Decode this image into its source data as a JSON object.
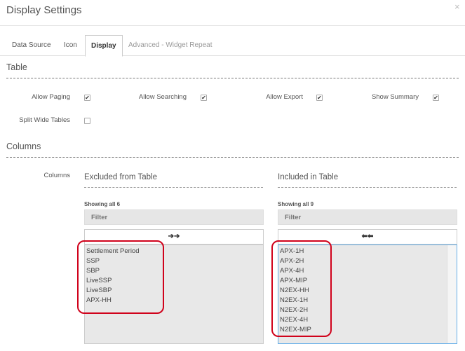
{
  "modal": {
    "title": "Display Settings",
    "close_glyph": "×"
  },
  "tabs": [
    {
      "label": "Data Source"
    },
    {
      "label": "Icon"
    },
    {
      "label": "Display"
    },
    {
      "label": "Advanced - Widget Repeat"
    }
  ],
  "table_section": {
    "title": "Table",
    "options": [
      {
        "label": "Allow Paging",
        "checked": "✔"
      },
      {
        "label": "Allow Searching",
        "checked": "✔"
      },
      {
        "label": "Allow Export",
        "checked": "✔"
      },
      {
        "label": "Show Summary",
        "checked": "✔"
      },
      {
        "label": "Split Wide Tables",
        "checked": ""
      }
    ]
  },
  "columns_section": {
    "title": "Columns",
    "field_label": "Columns",
    "excluded": {
      "title": "Excluded from Table",
      "showing": "Showing all 6",
      "filter_placeholder": "Filter",
      "move_glyph": "➔➔",
      "items": [
        "Settlement Period",
        "SSP",
        "SBP",
        "LiveSSP",
        "LiveSBP",
        "APX-HH"
      ]
    },
    "included": {
      "title": "Included in Table",
      "showing": "Showing all 9",
      "filter_placeholder": "Filter",
      "move_glyph": "⬅⬅",
      "items": [
        "APX-1H",
        "APX-2H",
        "APX-4H",
        "APX-MIP",
        "N2EX-HH",
        "N2EX-1H",
        "N2EX-2H",
        "N2EX-4H",
        "N2EX-MIP"
      ]
    }
  },
  "colors": {
    "annotation": "#d0021b",
    "focus_border": "#66afe9"
  }
}
